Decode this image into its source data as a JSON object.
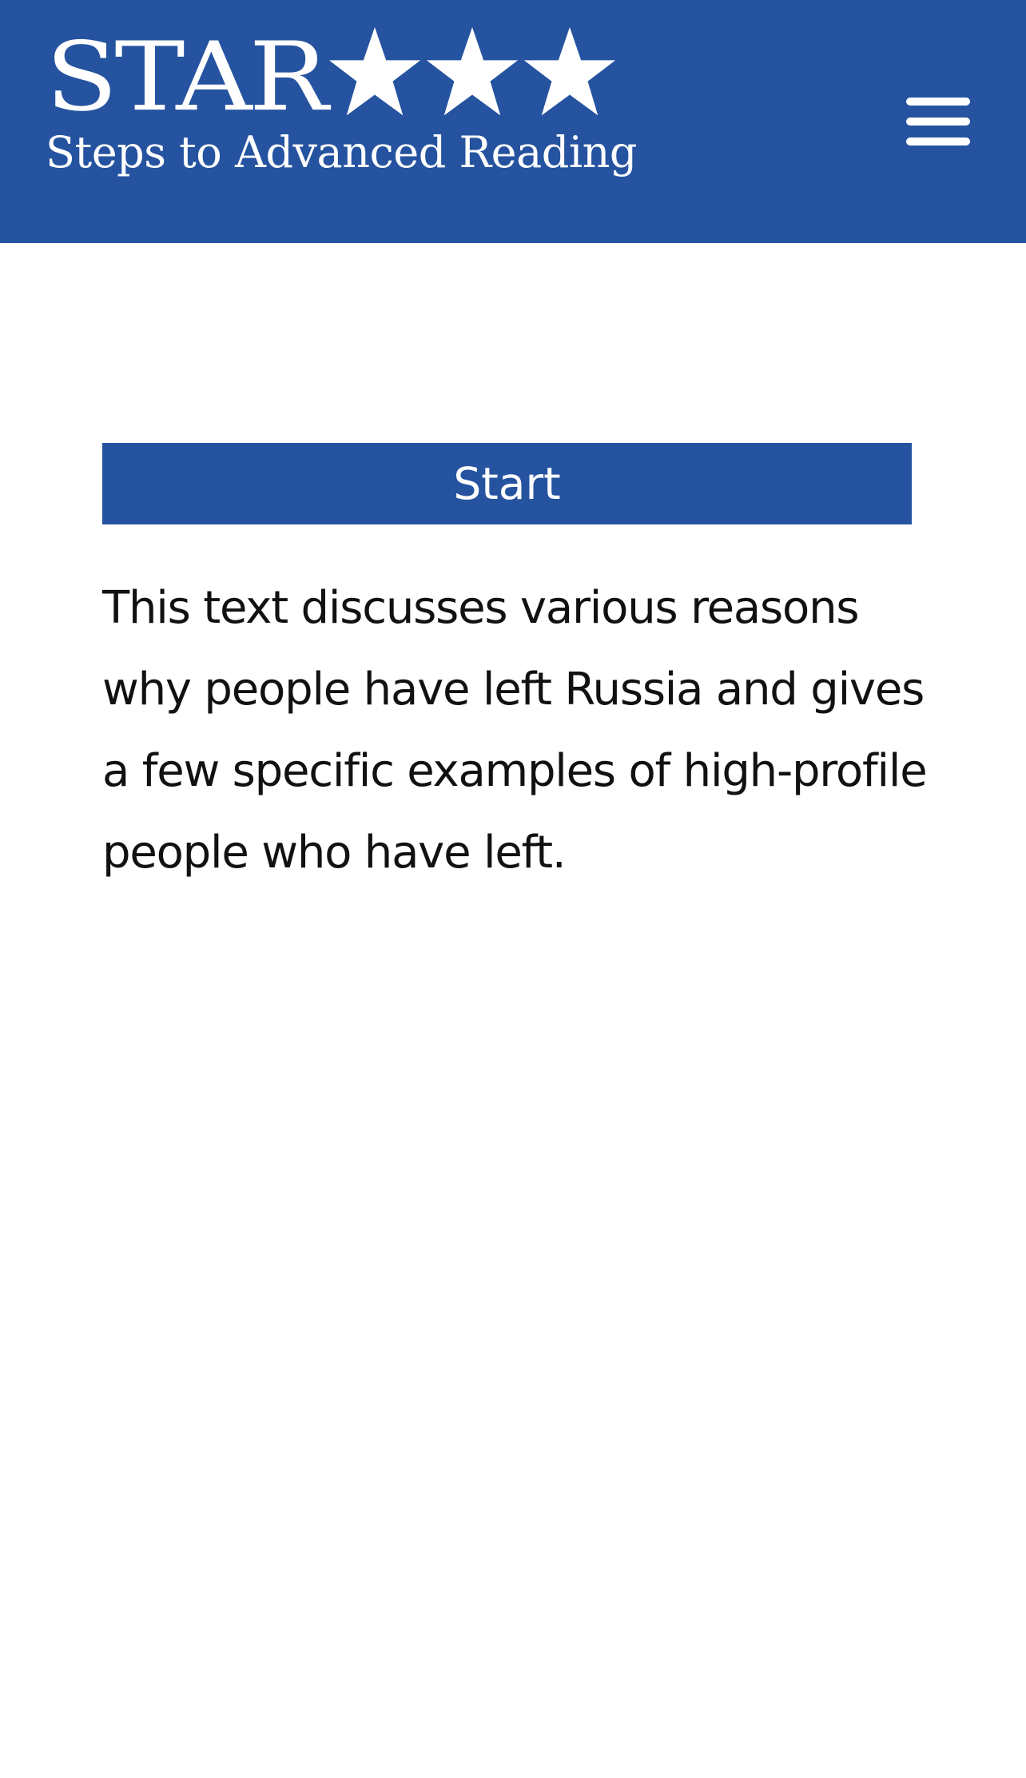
{
  "colors": {
    "brand_blue": "#2553a0",
    "text": "#111111",
    "background": "#ffffff"
  },
  "header": {
    "logo": {
      "wordmark": "STAR",
      "star_count": 3,
      "tagline": "Steps to Advanced Reading"
    },
    "menu_icon": "hamburger-menu-icon"
  },
  "main": {
    "start_label": "Start",
    "description": "This text discusses various reasons why people have left Russia and gives a few specific examples of high-profile people who have left."
  }
}
